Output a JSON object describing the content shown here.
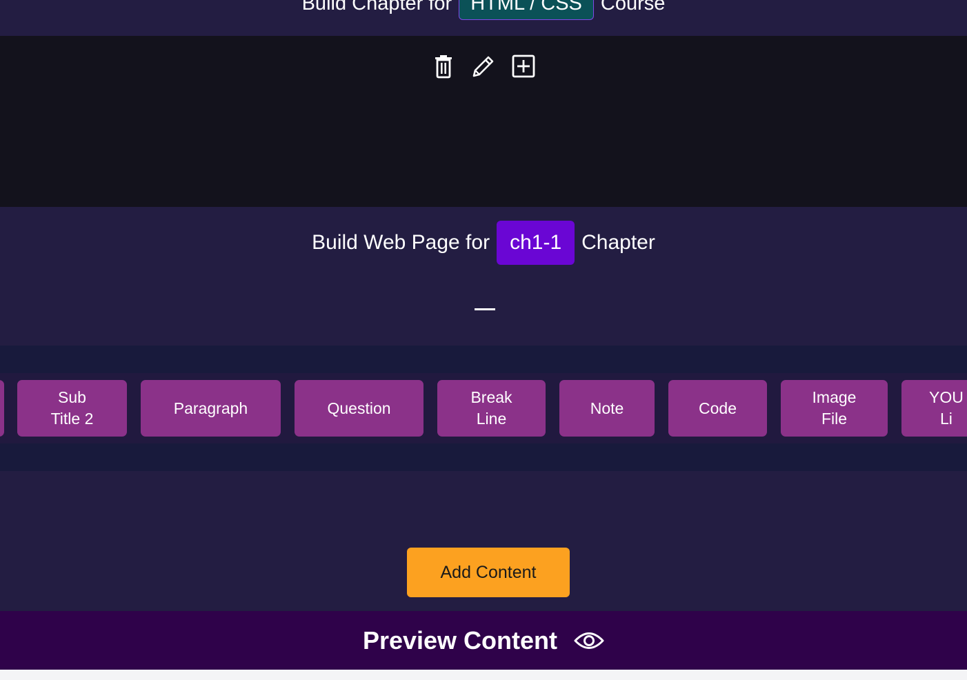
{
  "colors": {
    "header_bg": "#231d42",
    "panel_bg": "#13121c",
    "course_badge": "#0b5157",
    "chapter_badge": "#6a06d4",
    "component_button": "#8b3289",
    "add_button": "#fca120",
    "preview_bar": "#2f024a"
  },
  "chapter_header": {
    "prefix": "Build Chapter for",
    "course": "HTML / CSS",
    "suffix": "Course"
  },
  "chapter_actions": {
    "icons": [
      "trash-icon",
      "pencil-icon",
      "plus-square-icon"
    ]
  },
  "page_builder": {
    "prefix": "Build Web Page for",
    "chapter": "ch1-1",
    "suffix": "Chapter",
    "collapse_symbol": "—"
  },
  "components": [
    {
      "label": "Sub\nTitle 2"
    },
    {
      "label": "Paragraph"
    },
    {
      "label": "Question"
    },
    {
      "label": "Break\nLine"
    },
    {
      "label": "Note"
    },
    {
      "label": "Code"
    },
    {
      "label": "Image\nFile"
    },
    {
      "label": "YOU\nLi"
    }
  ],
  "add_content": {
    "label": "Add Content"
  },
  "preview": {
    "label": "Preview Content",
    "icon": "eye-icon"
  }
}
